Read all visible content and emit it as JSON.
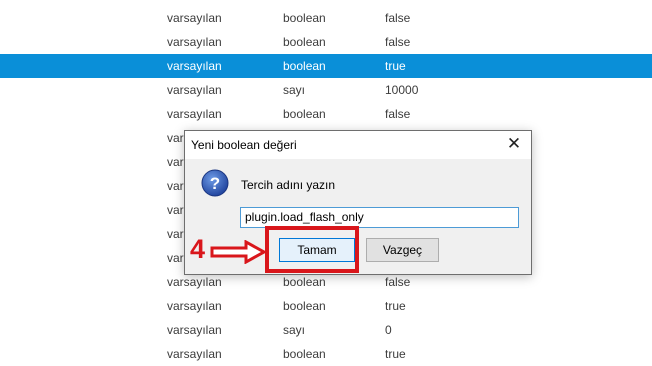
{
  "prefs": {
    "rows": [
      {
        "status": "varsayılan",
        "type": "boolean",
        "value": "false"
      },
      {
        "status": "varsayılan",
        "type": "boolean",
        "value": "false"
      },
      {
        "status": "varsayılan",
        "type": "boolean",
        "value": "true"
      },
      {
        "status": "varsayılan",
        "type": "sayı",
        "value": "10000"
      },
      {
        "status": "varsayılan",
        "type": "boolean",
        "value": "false"
      },
      {
        "status": "var",
        "type": "",
        "value": ""
      },
      {
        "status": "var",
        "type": "",
        "value": ""
      },
      {
        "status": "var",
        "type": "",
        "value": ""
      },
      {
        "status": "var",
        "type": "",
        "value": ""
      },
      {
        "status": "var",
        "type": "",
        "value": ""
      },
      {
        "status": "var",
        "type": "",
        "value": ""
      },
      {
        "status": "varsayılan",
        "type": "boolean",
        "value": "false"
      },
      {
        "status": "varsayılan",
        "type": "boolean",
        "value": "true"
      },
      {
        "status": "varsayılan",
        "type": "sayı",
        "value": "0"
      },
      {
        "status": "varsayılan",
        "type": "boolean",
        "value": "true"
      }
    ],
    "selected_index": 2
  },
  "dialog": {
    "title": "Yeni boolean değeri",
    "close_glyph": "✕",
    "prompt": "Tercih adını yazın",
    "input_value": "plugin.load_flash_only",
    "ok_label": "Tamam",
    "cancel_label": "Vazgeç"
  },
  "annotation": {
    "step_number": "4",
    "color": "#d9161b"
  },
  "colors": {
    "selection": "#0a8fd8",
    "accent_border": "#0078d7"
  }
}
